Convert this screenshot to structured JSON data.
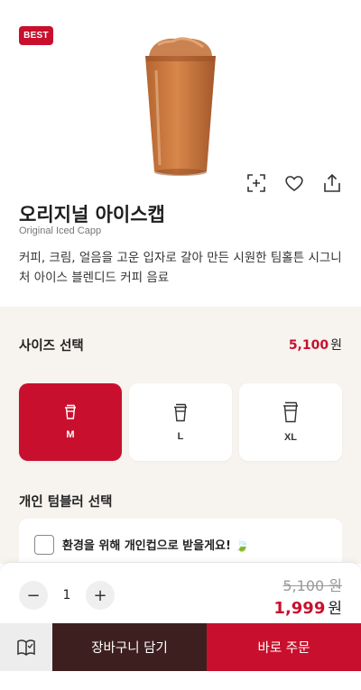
{
  "product": {
    "badge": "BEST",
    "name": "오리지널 아이스캡",
    "english_name": "Original Iced Capp",
    "description": "커피, 크림, 얼음을 고운 입자로 갈아 만든 시원한 팀홀튼 시그니처 아이스 블렌디드 커피 음료",
    "image": "iced-capp-drink"
  },
  "actions": {
    "icons": [
      "scan-icon",
      "heart-icon",
      "share-icon"
    ]
  },
  "size_section": {
    "heading": "사이즈 선택",
    "price": "5,100",
    "currency": "원",
    "options": [
      {
        "label": "M",
        "selected": true
      },
      {
        "label": "L",
        "selected": false
      },
      {
        "label": "XL",
        "selected": false
      }
    ]
  },
  "tumbler_section": {
    "heading": "개인 텀블러 선택",
    "option_text": "환경을 위해 개인컵으로 받을게요!",
    "leaf_glyph": "🍃",
    "checked": false
  },
  "order_bar": {
    "quantity": "1",
    "minus": "−",
    "plus": "+",
    "original_price": "5,100 원",
    "final_price": "1,999",
    "currency": "원",
    "cart_label": "장바구니 담기",
    "order_label": "바로 주문"
  },
  "colors": {
    "brand_red": "#c8102e",
    "dark_brown": "#3e1f1f",
    "panel_bg": "#f7f3ee"
  }
}
